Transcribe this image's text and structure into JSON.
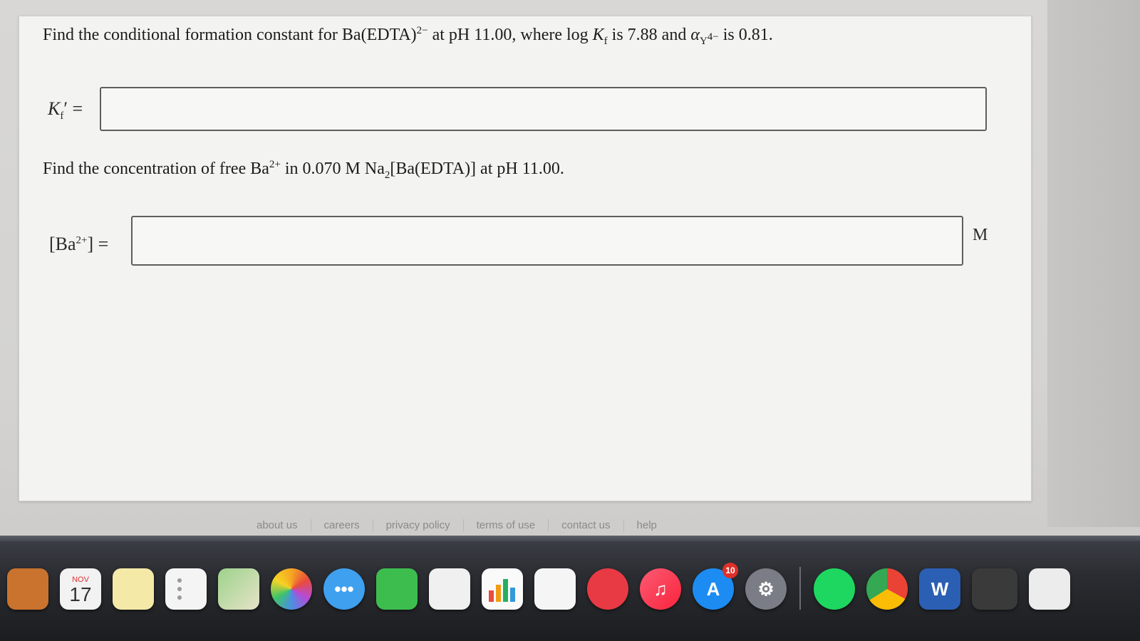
{
  "question1": {
    "text_a": "Find the conditional formation constant for Ba(EDTA)",
    "charge": "2−",
    "text_b": " at pH 11.00, where log ",
    "kf": "K",
    "kf_sub": "f",
    "text_c": " is 7.88 and ",
    "alpha": "α",
    "alpha_sub": "Y",
    "alpha_sup": "4−",
    "text_d": " is 0.81."
  },
  "kf_label": {
    "k": "K",
    "prime_sub": "f",
    "prime": "′",
    "eq": " ="
  },
  "kf_input": {
    "value": "",
    "placeholder": ""
  },
  "question2": {
    "text_a": "Find the concentration of free Ba",
    "ion_sup": "2+",
    "text_b": " in 0.070 M Na",
    "na_sub": "2",
    "text_c": "[Ba(EDTA)] at pH 11.00."
  },
  "ba_label": {
    "open": "[Ba",
    "sup": "2+",
    "close": "] ="
  },
  "ba_input": {
    "value": "",
    "placeholder": ""
  },
  "ba_unit": "M",
  "footer": {
    "links": [
      "about us",
      "careers",
      "privacy policy",
      "terms of use",
      "contact us",
      "help"
    ]
  },
  "dock": {
    "calendar_month": "NOV",
    "calendar_day": "17",
    "appstore_badge": "10",
    "word_label": "W",
    "icons": [
      "notes-app-icon",
      "calendar-icon",
      "stickies-icon",
      "reminders-icon",
      "maps-icon",
      "photos-icon",
      "messages-icon",
      "facetime-icon",
      "preview-icon",
      "numbers-icon",
      "keynote-icon",
      "news-icon",
      "music-icon",
      "appstore-icon",
      "system-preferences-icon",
      "spotify-icon",
      "chrome-icon",
      "word-icon",
      "screenshot-icon",
      "document-icon"
    ]
  },
  "colors": {
    "card_background": "#f3f3f2",
    "input_border": "#5e5e5e",
    "footer_text": "#8a8a8a",
    "dock_background": "#2a2c31"
  }
}
